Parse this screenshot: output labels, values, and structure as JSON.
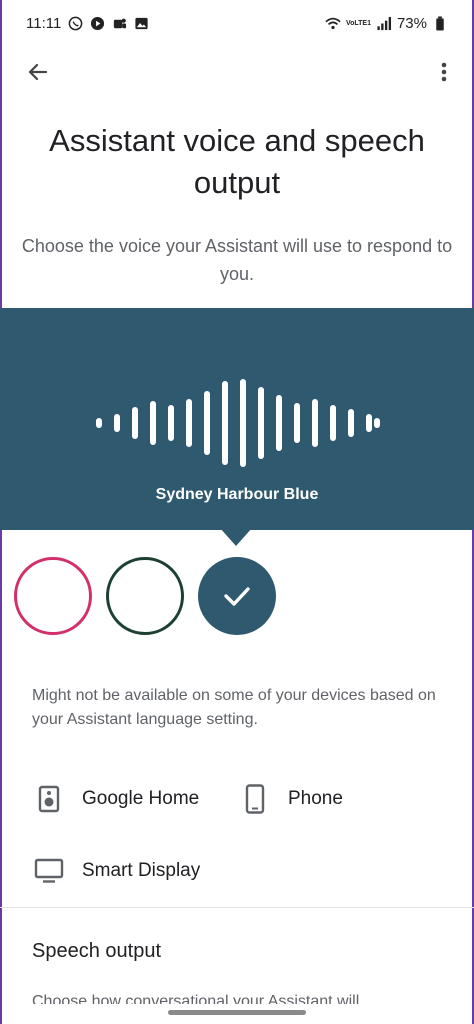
{
  "status_bar": {
    "time": "11:11",
    "lte_label": "VoLTE1",
    "battery": "73%"
  },
  "header": {
    "title": "Assistant voice and speech output"
  },
  "intro": {
    "text": "Choose the voice your Assistant will use to respond to you."
  },
  "voice_panel": {
    "selected_voice": "Sydney Harbour Blue",
    "background_color": "#2e596e"
  },
  "voice_options": [
    {
      "color": "#d3306b",
      "selected": false
    },
    {
      "color": "#1d4031",
      "selected": false
    },
    {
      "color": "#2e596e",
      "selected": true
    }
  ],
  "availability_note": "Might not be available on some of your devices based on your Assistant language setting.",
  "devices": [
    {
      "label": "Google Home",
      "icon": "speaker-icon"
    },
    {
      "label": "Phone",
      "icon": "phone-icon"
    },
    {
      "label": "Smart Display",
      "icon": "monitor-icon"
    }
  ],
  "speech_output": {
    "title": "Speech output",
    "description": "Choose how conversational your Assistant will"
  }
}
